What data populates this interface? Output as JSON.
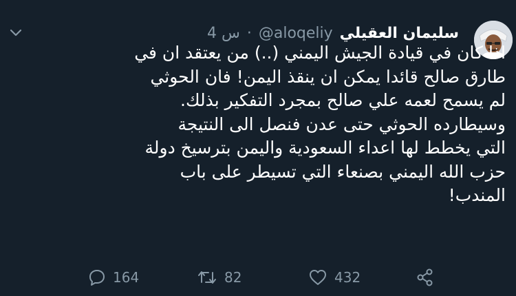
{
  "tweet": {
    "display_name": "سليمان العقيلي",
    "handle": "@aloqeliy",
    "separator": "·",
    "time": "4 س",
    "text_lines": [
      "اذا كان في قيادة الجيش اليمني (..) من يعتقد ان في",
      "طارق صالح قائدا يمكن ان ينقذ اليمن! فان الحوثي",
      "لم يسمح لعمه علي صالح بمجرد التفكير بذلك.",
      "وسيطارده الحوثي حتى عدن فنصل الى النتيجة",
      "التي يخطط لها اعداء السعودية واليمن بترسيخ دولة",
      "حزب الله اليمني بصنعاء التي تسيطر على باب",
      "المندب!"
    ],
    "actions": {
      "reply_count": "164",
      "retweet_count": "82",
      "like_count": "432"
    },
    "icons": [
      "chevron-down-icon",
      "reply-icon",
      "retweet-icon",
      "like-icon",
      "share-icon"
    ],
    "colors": {
      "background": "#15202b",
      "text": "#ffffff",
      "muted": "#8899a6"
    }
  }
}
